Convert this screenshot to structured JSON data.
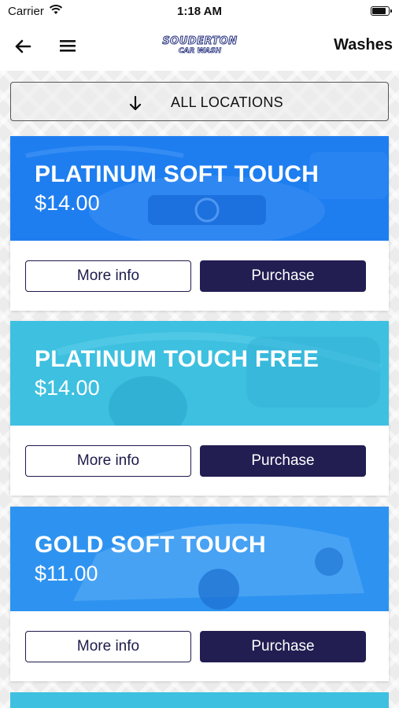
{
  "status": {
    "carrier": "Carrier",
    "time": "1:18 AM"
  },
  "nav": {
    "logo_line1": "SOUDERTON",
    "logo_line2": "CAR WASH",
    "title": "Washes"
  },
  "location_button": {
    "label": "ALL LOCATIONS"
  },
  "colors": {
    "blue": "#1e7ef0",
    "cyan": "#3ec0e0",
    "navy": "#221e52"
  },
  "washes": [
    {
      "name": "PLATINUM SOFT TOUCH",
      "price": "$14.00",
      "more": "More info",
      "buy": "Purchase",
      "color": "#1e7ef0"
    },
    {
      "name": "PLATINUM TOUCH FREE",
      "price": "$14.00",
      "more": "More info",
      "buy": "Purchase",
      "color": "#3ec0e0"
    },
    {
      "name": "GOLD SOFT TOUCH",
      "price": "$11.00",
      "more": "More info",
      "buy": "Purchase",
      "color": "#2e93f0"
    }
  ]
}
